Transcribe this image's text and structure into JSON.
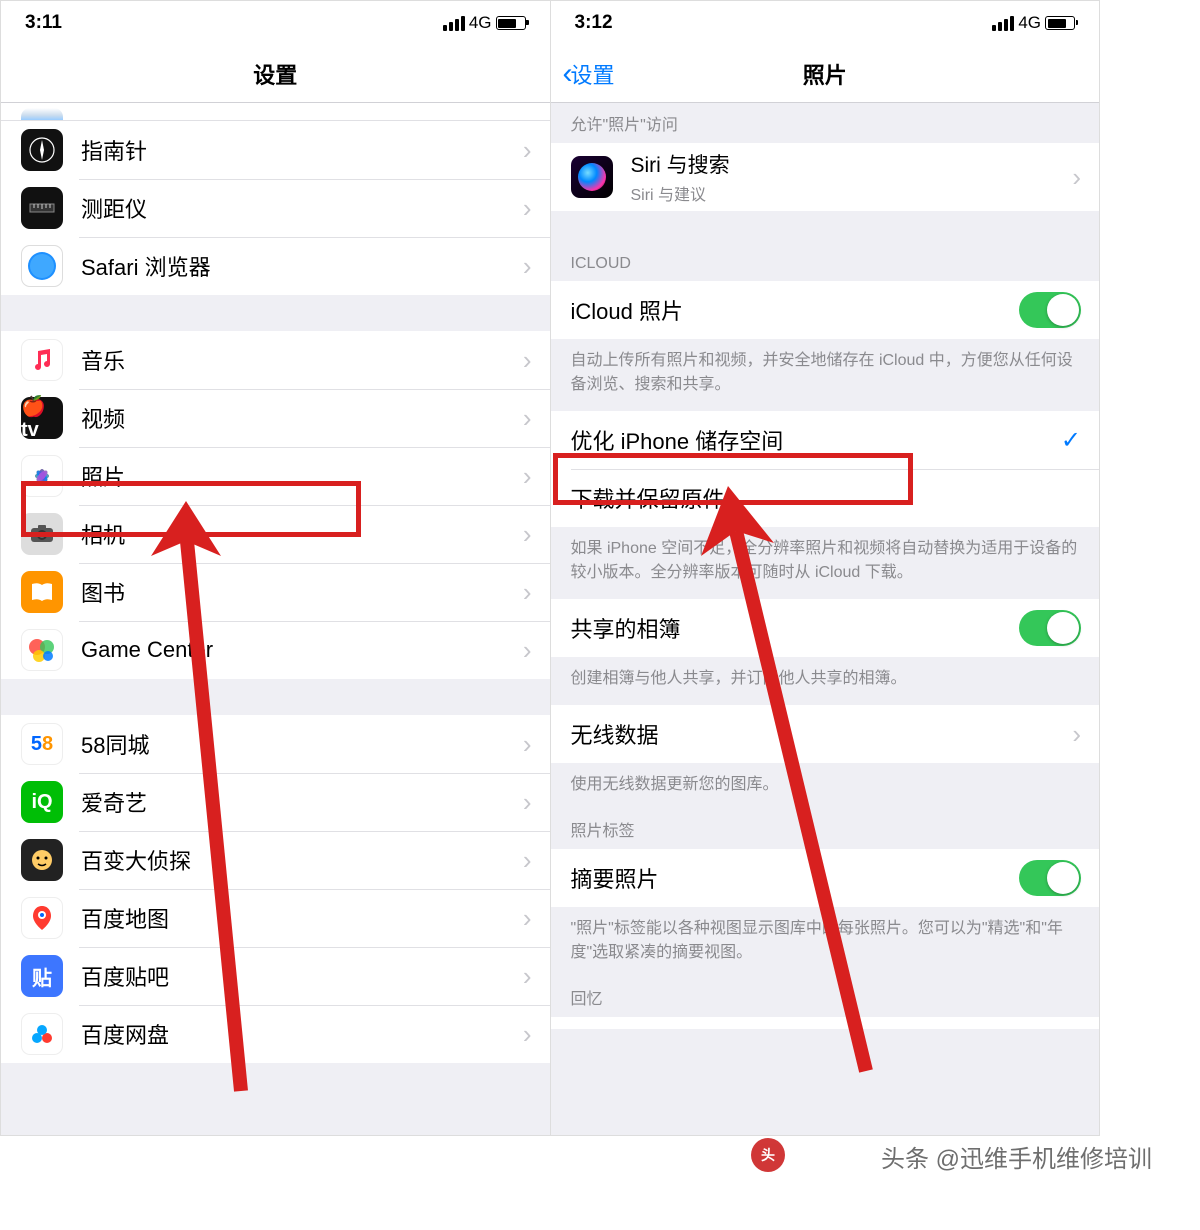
{
  "left": {
    "status": {
      "time": "3:11",
      "net": "4G"
    },
    "title": "设置",
    "items_a": [
      {
        "label": "指南针",
        "icon": "compass-icon"
      },
      {
        "label": "测距仪",
        "icon": "measure-icon"
      },
      {
        "label": "Safari 浏览器",
        "icon": "safari-icon"
      }
    ],
    "items_b": [
      {
        "label": "音乐",
        "icon": "music-icon"
      },
      {
        "label": "视频",
        "icon": "tv-icon"
      },
      {
        "label": "照片",
        "icon": "photos-icon"
      },
      {
        "label": "相机",
        "icon": "camera-icon"
      },
      {
        "label": "图书",
        "icon": "books-icon"
      },
      {
        "label": "Game Center",
        "icon": "gamecenter-icon"
      }
    ],
    "items_c": [
      {
        "label": "58同城",
        "icon": "58-icon"
      },
      {
        "label": "爱奇艺",
        "icon": "iqiyi-icon"
      },
      {
        "label": "百变大侦探",
        "icon": "bbd-icon"
      },
      {
        "label": "百度地图",
        "icon": "baidumap-icon"
      },
      {
        "label": "百度贴吧",
        "icon": "tieba-icon"
      },
      {
        "label": "百度网盘",
        "icon": "wangpan-icon"
      }
    ]
  },
  "right": {
    "status": {
      "time": "3:12",
      "net": "4G"
    },
    "back": "设置",
    "title": "照片",
    "allow_header": "允许\"照片\"访问",
    "siri": {
      "title": "Siri 与搜索",
      "sub": "Siri 与建议"
    },
    "icloud_header": "ICLOUD",
    "icloud_photos": "iCloud 照片",
    "icloud_footer": "自动上传所有照片和视频，并安全地储存在 iCloud 中，方便您从任何设备浏览、搜索和共享。",
    "optimize": "优化 iPhone 储存空间",
    "download": "下载并保留原件",
    "storage_footer": "如果 iPhone 空间不足，全分辨率照片和视频将自动替换为适用于设备的较小版本。全分辨率版本可随时从 iCloud 下载。",
    "shared_album": "共享的相簿",
    "shared_footer": "创建相簿与他人共享，并订阅他人共享的相簿。",
    "wireless": "无线数据",
    "wireless_footer": "使用无线数据更新您的图库。",
    "tags_header": "照片标签",
    "summary": "摘要照片",
    "summary_footer": "\"照片\"标签能以各种视图显示图库中的每张照片。您可以为\"精选\"和\"年度\"选取紧凑的摘要视图。",
    "memories_header": "回忆"
  },
  "watermark": "头条 @迅维手机维修培训"
}
